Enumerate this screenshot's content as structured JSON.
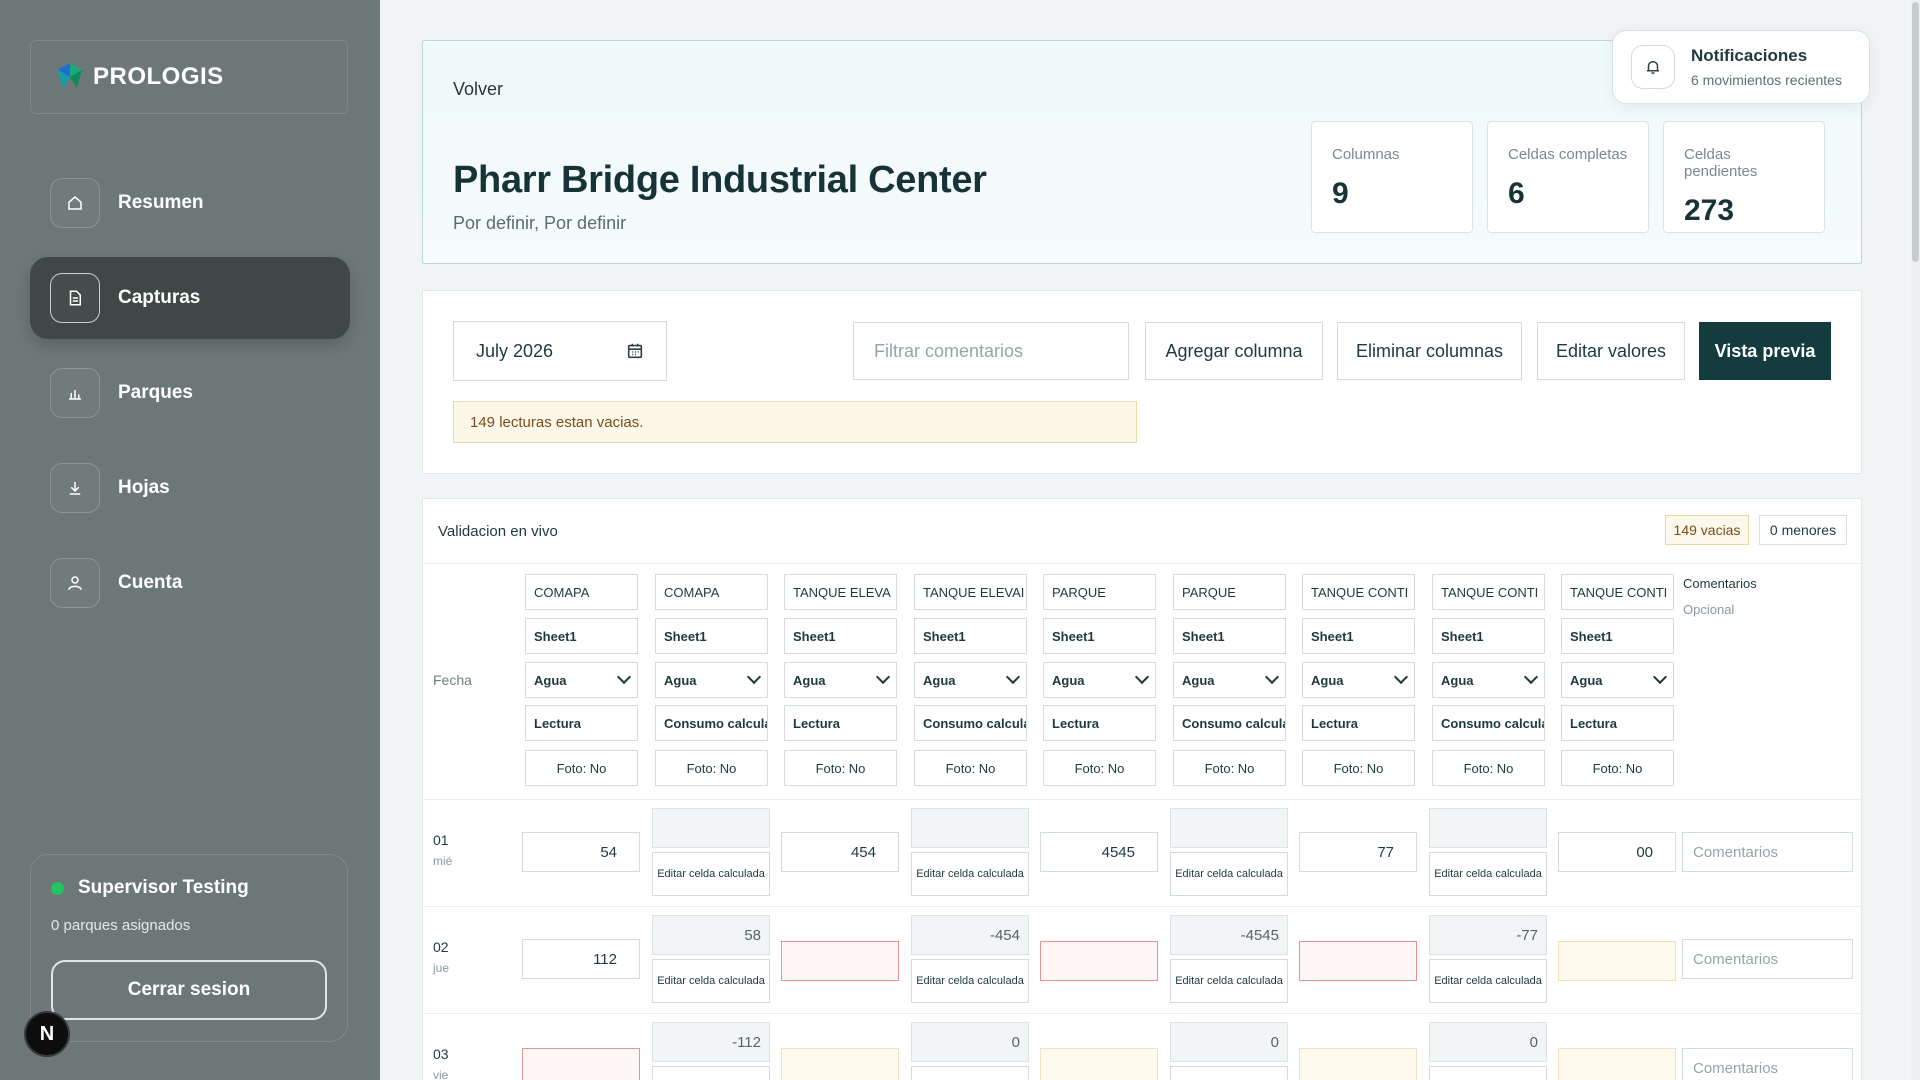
{
  "brand": {
    "name": "PROLOGIS"
  },
  "sidebar": {
    "items": [
      {
        "label": "Resumen",
        "icon": "home-icon"
      },
      {
        "label": "Capturas",
        "icon": "document-icon",
        "active": true
      },
      {
        "label": "Parques",
        "icon": "bar-chart-icon"
      },
      {
        "label": "Hojas",
        "icon": "download-icon"
      },
      {
        "label": "Cuenta",
        "icon": "user-icon"
      }
    ],
    "user": {
      "name": "Supervisor Testing",
      "sub": "0 parques asignados",
      "logout": "Cerrar sesion",
      "status_color": "#22c55e"
    },
    "badge": "N"
  },
  "header": {
    "back": "Volver",
    "title": "Pharr Bridge Industrial Center",
    "subtitle": "Por definir, Por definir",
    "stats": [
      {
        "label": "Columnas",
        "value": "9"
      },
      {
        "label": "Celdas completas",
        "value": "6"
      },
      {
        "label": "Celdas pendientes",
        "value": "273"
      }
    ]
  },
  "notifications": {
    "title": "Notificaciones",
    "sub": "6 movimientos recientes"
  },
  "toolbar": {
    "date": "July 2026",
    "filter_placeholder": "Filtrar comentarios",
    "add_column": "Agregar columna",
    "delete_columns": "Eliminar columnas",
    "edit_values": "Editar valores",
    "preview": "Vista previa",
    "warning": "149 lecturas estan vacias."
  },
  "grid": {
    "title": "Validacion en vivo",
    "badge_empty": "149 vacias",
    "badge_minor": "0 menores",
    "fecha_label": "Fecha",
    "comments_head": "Comentarios",
    "comments_sub": "Opcional",
    "comments_placeholder": "Comentarios",
    "calc_label": "Editar celda calculada",
    "columns": [
      {
        "name": "COMAPA",
        "sheet": "Sheet1",
        "type": "Agua",
        "kind": "Lectura",
        "photo": "Foto: No"
      },
      {
        "name": "COMAPA",
        "sheet": "Sheet1",
        "type": "Agua",
        "kind": "Consumo calcula",
        "photo": "Foto: No"
      },
      {
        "name": "TANQUE ELEVA",
        "sheet": "Sheet1",
        "type": "Agua",
        "kind": "Lectura",
        "photo": "Foto: No"
      },
      {
        "name": "TANQUE ELEVAI",
        "sheet": "Sheet1",
        "type": "Agua",
        "kind": "Consumo calcula",
        "photo": "Foto: No"
      },
      {
        "name": "PARQUE",
        "sheet": "Sheet1",
        "type": "Agua",
        "kind": "Lectura",
        "photo": "Foto: No"
      },
      {
        "name": "PARQUE",
        "sheet": "Sheet1",
        "type": "Agua",
        "kind": "Consumo calcula",
        "photo": "Foto: No"
      },
      {
        "name": "TANQUE CONTI",
        "sheet": "Sheet1",
        "type": "Agua",
        "kind": "Lectura",
        "photo": "Foto: No"
      },
      {
        "name": "TANQUE CONTI",
        "sheet": "Sheet1",
        "type": "Agua",
        "kind": "Consumo calcula",
        "photo": "Foto: No"
      },
      {
        "name": "TANQUE CONTI",
        "sheet": "Sheet1",
        "type": "Agua",
        "kind": "Lectura",
        "photo": "Foto: No"
      }
    ],
    "rows": [
      {
        "day": "01",
        "weekday": "mié",
        "cells": [
          "54",
          "",
          "454",
          "",
          "4545",
          "",
          "77",
          "",
          "00"
        ]
      },
      {
        "day": "02",
        "weekday": "jue",
        "cells": [
          "112",
          "58",
          "",
          "-454",
          "",
          "-4545",
          "",
          "-77",
          ""
        ]
      },
      {
        "day": "03",
        "weekday": "vie",
        "cells": [
          "",
          "-112",
          "",
          "0",
          "",
          "0",
          "",
          "0",
          ""
        ]
      }
    ]
  }
}
